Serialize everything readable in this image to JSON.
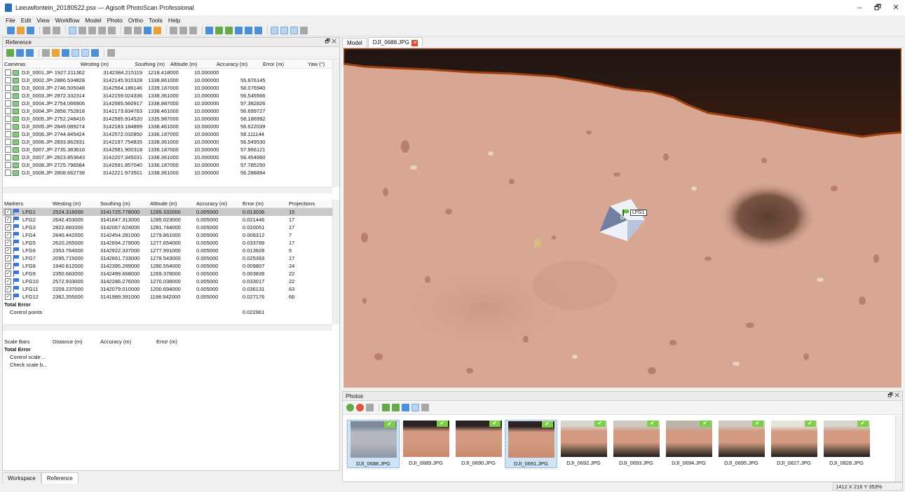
{
  "window": {
    "title": "Leeuwfontein_20180522.psx — Agisoft PhotoScan Professional",
    "controls": [
      "–",
      "🗗",
      "✕"
    ]
  },
  "menu": [
    "File",
    "Edit",
    "View",
    "Workflow",
    "Model",
    "Photo",
    "Ortho",
    "Tools",
    "Help"
  ],
  "reference_panel": {
    "title": "Reference",
    "cameras": {
      "headers": [
        "Cameras",
        "Westing (m)",
        "Southing (m)",
        "Altitude (m)",
        "Accuracy (m)",
        "Error (m)",
        "Yaw (°)"
      ],
      "rows": [
        [
          "DJI_0001.JPG",
          "1927.211362",
          "3142384.215119",
          "1218.418000",
          "10.000000",
          ""
        ],
        [
          "DJI_0002.JPG",
          "2886.534828",
          "3142145.910328",
          "1338.861000",
          "10.000000",
          "55.876145"
        ],
        [
          "DJI_0003.JPG",
          "2746.505048",
          "3142564.186146",
          "1339.187000",
          "10.000000",
          "58.076940"
        ],
        [
          "DJI_0003.JPG",
          "2872.332314",
          "3142159.024336",
          "1338.361000",
          "10.000000",
          "56.545566"
        ],
        [
          "DJI_0004.JPG",
          "2754.066906",
          "3142565.560917",
          "1338.887000",
          "10.000000",
          "57.382826"
        ],
        [
          "DJI_0004.JPG",
          "2858.752818",
          "3142173.834763",
          "1338.461000",
          "10.000000",
          "56.699727"
        ],
        [
          "DJI_0005.JPG",
          "2752.248416",
          "3142565.914520",
          "1335.987000",
          "10.000000",
          "58.186992"
        ],
        [
          "DJI_0005.JPG",
          "2849.089274",
          "3142183.184899",
          "1338.461000",
          "10.000000",
          "56.622039"
        ],
        [
          "DJI_0006.JPG",
          "2744.845424",
          "3142572.032850",
          "1336.187000",
          "10.000000",
          "58.111144"
        ],
        [
          "DJI_0006.JPG",
          "2833.862931",
          "3142197.754835",
          "1338.361000",
          "10.000000",
          "56.549530"
        ],
        [
          "DJI_0007.JPG",
          "2735.383616",
          "3142581.900318",
          "1336.187000",
          "10.000000",
          "57.966121"
        ],
        [
          "DJI_0007.JPG",
          "2823.853643",
          "3142207.345031",
          "1338.361000",
          "10.000000",
          "56.454660"
        ],
        [
          "DJI_0008.JPG",
          "2725.796584",
          "3142591.857040",
          "1336.187000",
          "10.000000",
          "57.785250"
        ],
        [
          "DJI_0008.JPG",
          "2808.662738",
          "3142221.973501",
          "1338.361000",
          "10.000000",
          "56.288894"
        ]
      ]
    },
    "markers": {
      "headers": [
        "Markers",
        "Westing (m)",
        "Southing (m)",
        "Altitude (m)",
        "Accuracy (m)",
        "Error (m)",
        "Projections"
      ],
      "rows": [
        [
          "LFG1",
          "2524.316000",
          "3141725.778000",
          "1285.332000",
          "0.005000",
          "0.013036",
          "15"
        ],
        [
          "LFG2",
          "2642.453000",
          "3141847.313000",
          "1285.023000",
          "0.005000",
          "0.021446",
          "17"
        ],
        [
          "LFG3",
          "2822.681000",
          "3142067.624000",
          "1281.744000",
          "0.005000",
          "0.020051",
          "17"
        ],
        [
          "LFG4",
          "2840.442000",
          "3142454.281000",
          "1279.861000",
          "0.005000",
          "0.008312",
          "7"
        ],
        [
          "LFG5",
          "2620.265000",
          "3142694.279000",
          "1277.654000",
          "0.005000",
          "0.033789",
          "17"
        ],
        [
          "LFG6",
          "2353.764000",
          "3142922.337000",
          "1277.991000",
          "0.005000",
          "0.013928",
          "5"
        ],
        [
          "LFG7",
          "2095.715000",
          "3142661.733000",
          "1278.543000",
          "0.005000",
          "0.025393",
          "17"
        ],
        [
          "LFG8",
          "1940.812000",
          "3142395.299000",
          "1280.554000",
          "0.005000",
          "0.009807",
          "24"
        ],
        [
          "LFG9",
          "2350.683000",
          "3142499.668000",
          "1269.378000",
          "0.005000",
          "0.003839",
          "22"
        ],
        [
          "LFG10",
          "2572.933000",
          "3142286.276000",
          "1270.038000",
          "0.005000",
          "0.033017",
          "22"
        ],
        [
          "LFG11",
          "2209.237000",
          "3142079.010000",
          "1200.694000",
          "0.005000",
          "0.036131",
          "63"
        ],
        [
          "LFG12",
          "2362.355000",
          "3141989.391000",
          "1198.942000",
          "0.005000",
          "0.027176",
          "66"
        ]
      ],
      "total_error_label": "Total Error",
      "control_points_label": "Control points",
      "control_points_error": "0.022961"
    },
    "scale_bars": {
      "headers": [
        "Scale Bars",
        "Distance (m)",
        "Accuracy (m)",
        "Error (m)"
      ],
      "total_error_label": "Total Error",
      "items": [
        "Control scale ...",
        "Check scale b..."
      ]
    }
  },
  "bottom_tabs": [
    "Workspace",
    "Reference"
  ],
  "view_tabs": {
    "model": "Model",
    "photo": "DJI_0688.JPG"
  },
  "marker_label": "LFG1",
  "photos_panel": {
    "title": "Photos",
    "thumbnails": [
      "DJI_0688.JPG",
      "DJI_0689.JPG",
      "DJI_0690.JPG",
      "DJI_0691.JPG",
      "DJI_0692.JPG",
      "DJI_0693.JPG",
      "DJI_0694.JPG",
      "DJI_0695.JPG",
      "DJI_0827.JPG",
      "DJI_0828.JPG"
    ]
  },
  "status": "1412 X 216 Y 353%",
  "colors": {
    "ground": "#d8a794",
    "shadow": "#1e1513",
    "selection": "#cfe3f7",
    "close_tab": "#e04b2c"
  }
}
